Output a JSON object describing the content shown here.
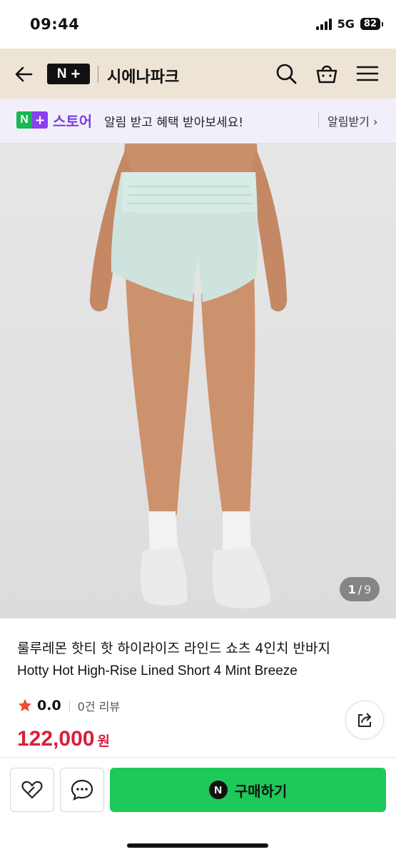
{
  "status_bar": {
    "time": "09:44",
    "network": "5G",
    "battery": "82"
  },
  "header": {
    "logo_letter": "N",
    "logo_plus": "+",
    "store_name": "시에나파크",
    "icons": [
      "back-arrow-icon",
      "search-icon",
      "shopping-bag-icon",
      "menu-icon"
    ],
    "background": "#ede4d6"
  },
  "banner": {
    "logo_letter": "N",
    "logo_plus": "+",
    "store_label": "스토어",
    "message": "알림 받고 혜택 받아보세요!",
    "action_label": "알림받기 ›",
    "accent": "#7b3fe4"
  },
  "gallery": {
    "current": "1",
    "separator": "/",
    "total": "9"
  },
  "product": {
    "title_ko": "룰루레몬 핫티 핫 하이라이즈 라인드 쇼츠 4인치 반바지",
    "title_en": "Hotty Hot High-Rise Lined Short 4 Mint Breeze",
    "rating": "0.0",
    "review_count": "0건 리뷰",
    "price": "122,000",
    "currency": "원",
    "price_color": "#d71f3a"
  },
  "bottom_bar": {
    "buy_icon_letter": "N",
    "buy_label": "구매하기",
    "buy_color": "#1ec85a",
    "icons": [
      "heart-icon",
      "chat-icon"
    ]
  }
}
